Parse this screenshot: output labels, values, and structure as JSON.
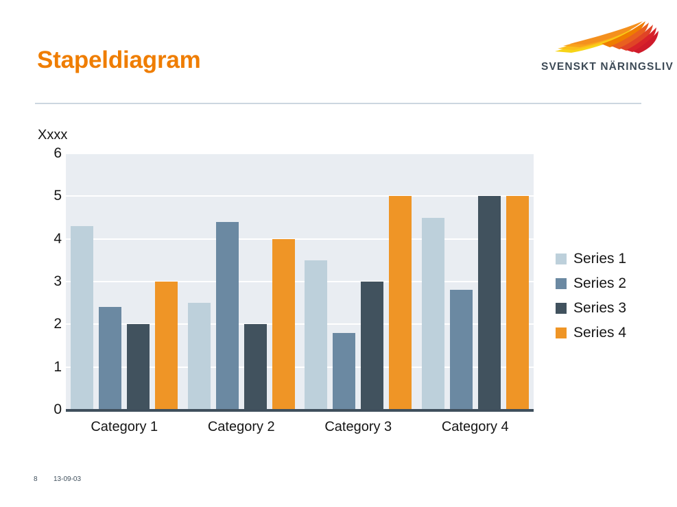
{
  "header": {
    "title": "Stapeldiagram"
  },
  "logo": {
    "wordmark": "SVENSKT NÄRINGSLIV",
    "icon_name": "svenskt-naringsliv-wing-logo",
    "colors": {
      "yellow": "#f7d417",
      "orange": "#ef7d00",
      "red": "#d8232a"
    }
  },
  "footer": {
    "page_number": "8",
    "date": "13-09-03"
  },
  "theme": {
    "title_color": "#ef7d00",
    "divider_color": "#ccd6e0",
    "plot_background": "#e9edf2",
    "axis_color": "#3f4f5c",
    "gridline_color": "#ffffff"
  },
  "chart_data": {
    "type": "bar",
    "title": "Stapeldiagram",
    "xlabel": "",
    "ylabel": "Xxxx",
    "ylim": [
      0,
      6
    ],
    "yticks": [
      0,
      1,
      2,
      3,
      4,
      5,
      6
    ],
    "ytick_labels": [
      "0",
      "1",
      "2",
      "3",
      "4",
      "5",
      "6"
    ],
    "grid": true,
    "legend_position": "right",
    "categories": [
      "Category 1",
      "Category 2",
      "Category 3",
      "Category 4"
    ],
    "series": [
      {
        "name": "Series 1",
        "color": "#bdd0db",
        "values": [
          4.3,
          2.5,
          3.5,
          4.5
        ]
      },
      {
        "name": "Series 2",
        "color": "#6b89a2",
        "values": [
          2.4,
          4.4,
          1.8,
          2.8
        ]
      },
      {
        "name": "Series 3",
        "color": "#41525e",
        "values": [
          2.0,
          2.0,
          3.0,
          5.0
        ]
      },
      {
        "name": "Series 4",
        "color": "#ef9526",
        "values": [
          3.0,
          4.0,
          5.0,
          5.0
        ]
      }
    ]
  }
}
